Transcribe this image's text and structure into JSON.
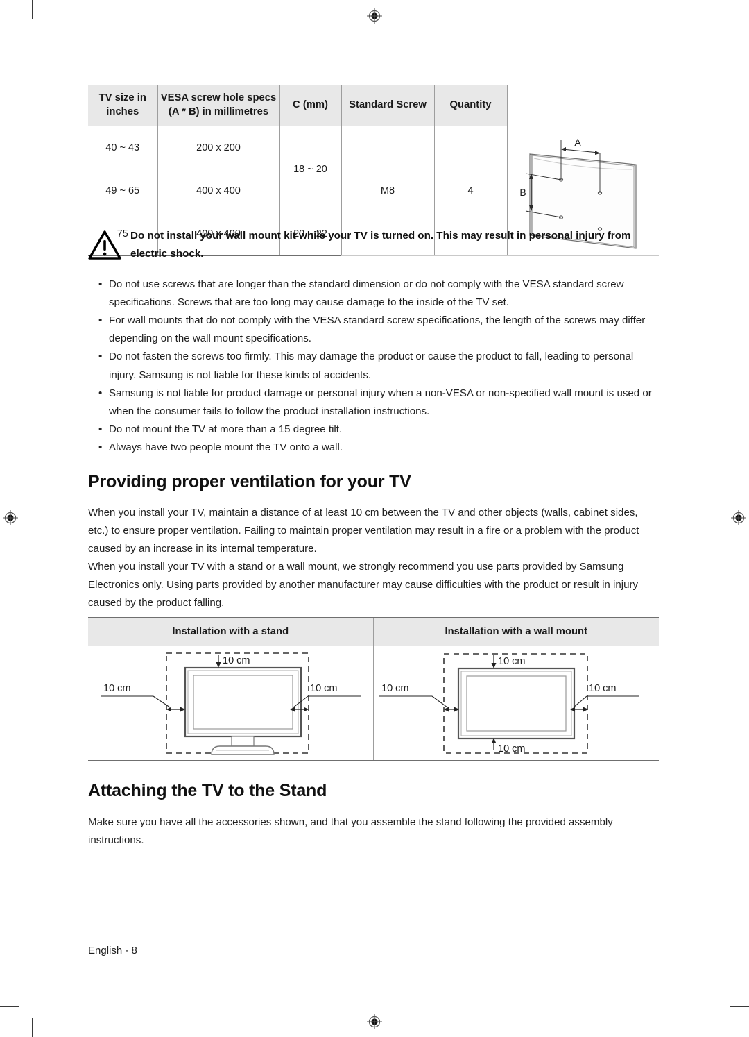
{
  "page": {
    "footer_label": "English - 8"
  },
  "spec_table": {
    "headers": [
      "TV size in inches",
      "VESA screw hole specs (A * B) in millimetres",
      "C (mm)",
      "Standard Screw",
      "Quantity"
    ],
    "header_lines": {
      "h1_line1": "TV size in",
      "h1_line2": "inches",
      "h2_line1": "VESA screw hole specs",
      "h2_line2": "(A * B) in millimetres",
      "h3": "C (mm)",
      "h4": "Standard Screw",
      "h5": "Quantity"
    },
    "rows": [
      {
        "tv_size": "40 ~ 43",
        "vesa": "200 x 200"
      },
      {
        "tv_size": "49 ~ 65",
        "vesa": "400 x 400"
      },
      {
        "tv_size": "75",
        "vesa": "400 x 400"
      }
    ],
    "c_mm_merged": "18 ~ 20",
    "c_mm_last": "20 ~ 22",
    "standard_screw": "M8",
    "quantity": "4",
    "diagram": {
      "label_a": "A",
      "label_b": "B"
    }
  },
  "warning": {
    "icon": "warning-triangle-icon",
    "text": "Do not install your wall mount kit while your TV is turned on. This may result in personal injury from electric shock."
  },
  "wallmount_bullets": [
    "Do not use screws that are longer than the standard dimension or do not comply with the VESA standard screw specifications. Screws that are too long may cause damage to the inside of the TV set.",
    "For wall mounts that do not comply with the VESA standard screw specifications, the length of the screws may differ depending on the wall mount specifications.",
    "Do not fasten the screws too firmly. This may damage the product or cause the product to fall, leading to personal injury. Samsung is not liable for these kinds of accidents.",
    "Samsung is not liable for product damage or personal injury when a non-VESA or non-specified wall mount is used or when the consumer fails to follow the product installation instructions.",
    "Do not mount the TV at more than a 15 degree tilt.",
    "Always have two people mount the TV onto a wall."
  ],
  "ventilation": {
    "title": "Providing proper ventilation for your TV",
    "paragraph1": "When you install your TV, maintain a distance of at least 10 cm between the TV and other objects (walls, cabinet sides, etc.) to ensure proper ventilation. Failing to maintain proper ventilation may result in a fire or a problem with the product caused by an increase in its internal temperature.",
    "paragraph2": "When you install your TV with a stand or a wall mount, we strongly recommend you use parts provided by Samsung Electronics only. Using parts provided by another manufacturer may cause difficulties with the product or result in injury caused by the product falling.",
    "table": {
      "header_stand": "Installation with a stand",
      "header_wallmount": "Installation with a wall mount",
      "stand_labels": {
        "top": "10 cm",
        "left": "10 cm",
        "right": "10 cm"
      },
      "wallmount_labels": {
        "top": "10 cm",
        "left": "10 cm",
        "right": "10 cm",
        "bottom": "10 cm"
      }
    }
  },
  "attaching": {
    "title": "Attaching the TV to the Stand",
    "paragraph": "Make sure you have all the accessories shown, and that you assemble the stand following the provided assembly instructions."
  }
}
